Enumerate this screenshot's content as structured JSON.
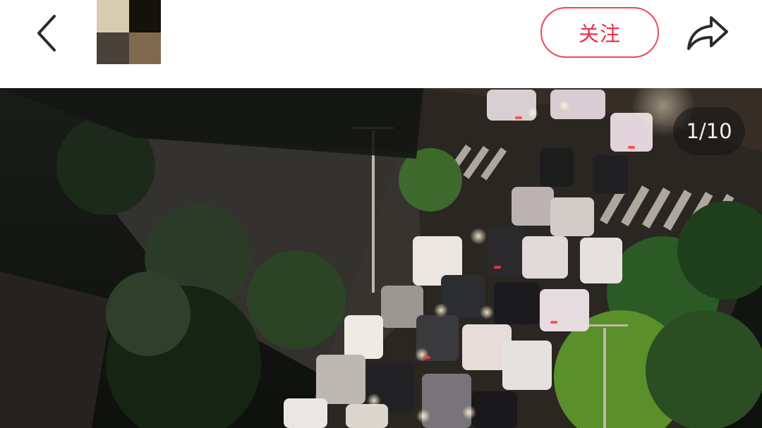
{
  "header": {
    "follow_label": "关注",
    "back_icon": "chevron-left-icon",
    "share_icon": "share-arrow-icon",
    "avatar_colors": [
      "#d8ccb0",
      "#15110b",
      "#4a423a",
      "#806a4e"
    ]
  },
  "image_viewer": {
    "counter": "1/10",
    "scene": "night-street-traffic-jam-photo"
  },
  "colors": {
    "accent": "#ee2e44",
    "background": "#ffffff",
    "icon": "#2b2b2b"
  }
}
